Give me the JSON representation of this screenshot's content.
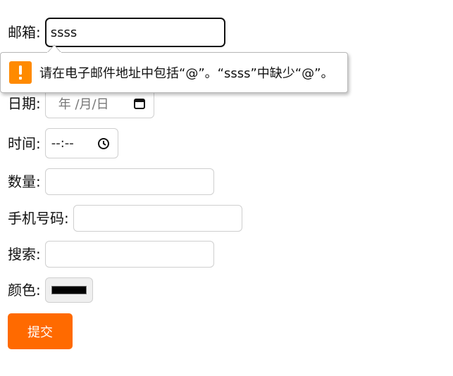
{
  "form": {
    "email": {
      "label": "邮箱:",
      "value": "ssss"
    },
    "date": {
      "label": "日期:",
      "placeholder": "年 /月/日"
    },
    "time": {
      "label": "时间:",
      "placeholder": "--:--"
    },
    "quantity": {
      "label": "数量:",
      "value": ""
    },
    "phone": {
      "label": "手机号码:",
      "value": ""
    },
    "search": {
      "label": "搜索:",
      "value": ""
    },
    "color": {
      "label": "颜色:",
      "value": "#000000"
    },
    "submit_label": "提交"
  },
  "validation": {
    "message": "请在电子邮件地址中包括“@”。“ssss”中缺少“@”。",
    "icon": "warning-icon",
    "icon_color": "#ff8a00"
  },
  "colors": {
    "submit_background": "#ff6a00",
    "input_border": "#cfcfcf",
    "focus_border": "#111111"
  }
}
